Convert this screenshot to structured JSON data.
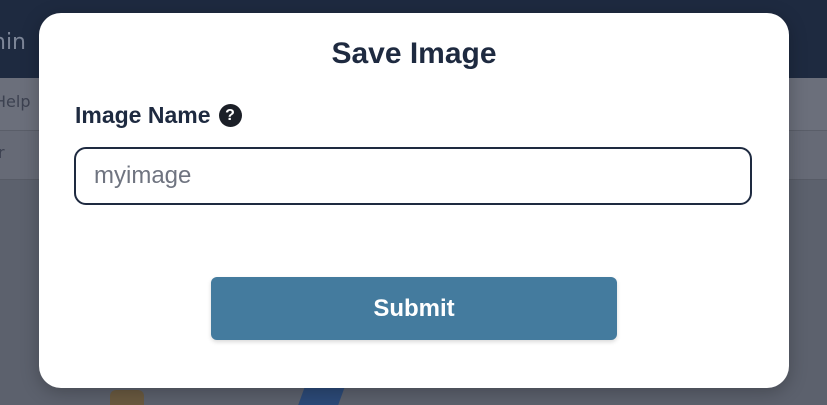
{
  "background": {
    "title_fragment": "nin",
    "menu_fragment": "Help",
    "toolbar_fragment": "r"
  },
  "dialog": {
    "title": "Save Image",
    "field_label": "Image Name",
    "help_icon": "question-circle-icon",
    "input_value": "",
    "input_placeholder": "myimage",
    "submit_label": "Submit"
  },
  "colors": {
    "title_text": "#1e2a40",
    "submit_button": "#447b9e",
    "input_border": "#1e2a40",
    "overlay": "#5d6270"
  }
}
